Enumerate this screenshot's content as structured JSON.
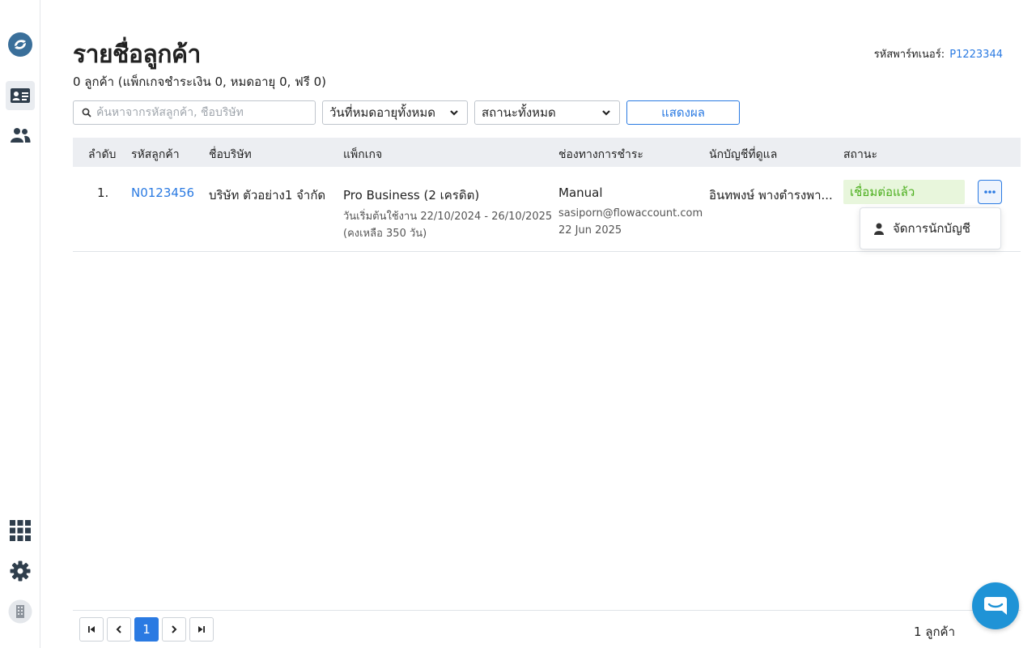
{
  "page": {
    "title": "รายชื่อลูกค้า",
    "summary": "0 ลูกค้า (แพ็กเกจชำระเงิน 0, หมดอายุ 0, ฟรี 0)",
    "partner_label": "รหัสพาร์ทเนอร์:",
    "partner_code": "P1223344"
  },
  "sidebar": {
    "items": [
      {
        "icon": "logo-icon"
      },
      {
        "icon": "contact-card-icon",
        "active": true
      },
      {
        "icon": "users-icon"
      },
      {
        "icon": "apps-grid-icon"
      },
      {
        "icon": "gear-icon"
      },
      {
        "icon": "building-icon"
      }
    ]
  },
  "filters": {
    "search_placeholder": "ค้นหาจากรหัสลูกค้า, ชื่อบริษัท",
    "expiry_select": "วันที่หมดอายุทั้งหมด",
    "status_select": "สถานะทั้งหมด",
    "show_button": "แสดงผล"
  },
  "table": {
    "headers": [
      "ลำดับ",
      "รหัสลูกค้า",
      "ชื่อบริษัท",
      "แพ็กเกจ",
      "ช่องทางการชำระ",
      "นักบัญชีที่ดูแล",
      "สถานะ"
    ],
    "rows": [
      {
        "index": "1.",
        "customer_code": "N0123456",
        "company": "บริษัท ตัวอย่าง1 จำกัด",
        "package": "Pro Business (2 เครดิต)",
        "package_period": "วันเริ่มต้นใช้งาน 22/10/2024 - 26/10/2025",
        "package_remaining": "(คงเหลือ 350 วัน)",
        "payment_channel": "Manual",
        "payment_email": "sasiporn@flowaccount.com",
        "payment_date": "22 Jun 2025",
        "accountant": "อินทพงษ์ พางตำรงพา...",
        "status": "เชื่อมต่อแล้ว"
      }
    ]
  },
  "row_menu": {
    "items": [
      "จัดการนักบัญชี"
    ]
  },
  "pagination": {
    "current_page": "1",
    "total": "1 ลูกค้า"
  },
  "colors": {
    "accent": "#2a7ae2",
    "status_bg": "#e8f6dc",
    "status_text": "#4caf1e",
    "chat": "#1f93d6"
  }
}
